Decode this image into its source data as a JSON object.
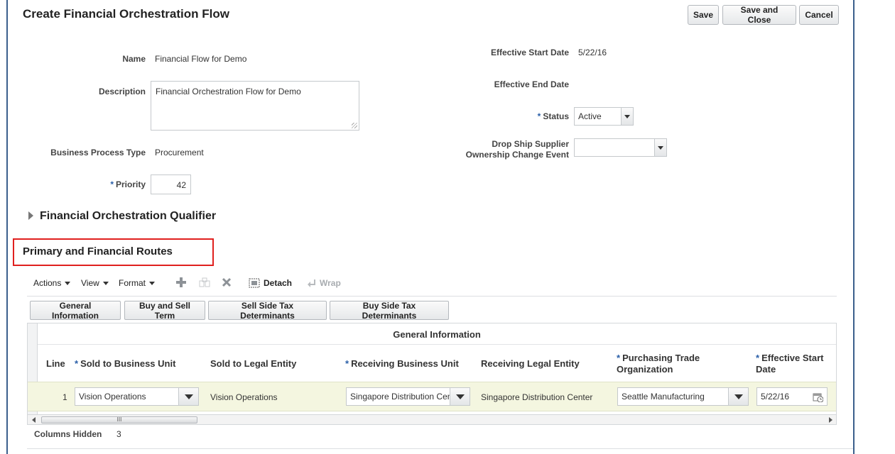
{
  "page": {
    "title": "Create Financial Orchestration Flow"
  },
  "buttons": {
    "save": "Save",
    "save_close": "Save and Close",
    "cancel": "Cancel"
  },
  "form": {
    "name_label": "Name",
    "name_value": "Financial Flow for Demo",
    "description_label": "Description",
    "description_value": "Financial Orchestration Flow for Demo",
    "bpt_label": "Business Process Type",
    "bpt_value": "Procurement",
    "priority_label": "Priority",
    "priority_value": "42",
    "start_label": "Effective Start Date",
    "start_value": "5/22/16",
    "end_label": "Effective End Date",
    "status_label": "Status",
    "status_value": "Active",
    "dropship_label_1": "Drop Ship Supplier",
    "dropship_label_2": "Ownership Change Event",
    "dropship_value": "",
    "required_mark": "*"
  },
  "sections": {
    "qualifier": "Financial Orchestration Qualifier",
    "routes": "Primary and Financial Routes"
  },
  "toolbar": {
    "actions": "Actions",
    "view": "View",
    "format": "Format",
    "detach": "Detach",
    "wrap": "Wrap"
  },
  "tabs": [
    "General Information",
    "Buy and Sell Term",
    "Sell Side Tax Determinants",
    "Buy Side Tax Determinants"
  ],
  "table": {
    "group_header": "General Information",
    "headers": {
      "line": "Line",
      "sold_bu": "Sold to Business Unit",
      "sold_le": "Sold to Legal Entity",
      "recv_bu": "Receiving Business Unit",
      "recv_le": "Receiving Legal Entity",
      "pto_1": "Purchasing Trade",
      "pto_2": "Organization",
      "esd_1": "Effective Start",
      "esd_2": "Date"
    },
    "row": {
      "line": "1",
      "sold_bu": "Vision Operations",
      "sold_le": "Vision Operations",
      "recv_bu": "Singapore Distribution Center",
      "recv_le": "Singapore Distribution Center",
      "pto": "Seattle Manufacturing",
      "esd": "5/22/16"
    },
    "scroll_grip": "III"
  },
  "footer": {
    "columns_hidden_label": "Columns Hidden",
    "columns_hidden_value": "3"
  }
}
